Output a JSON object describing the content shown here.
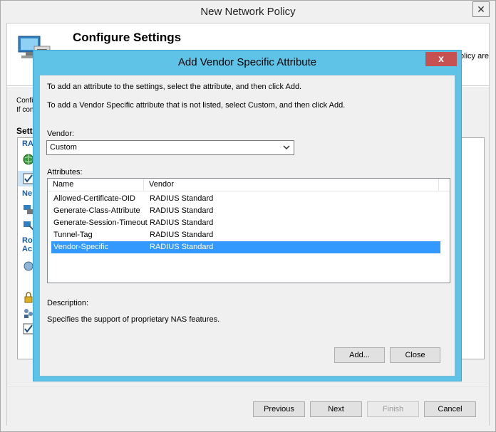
{
  "main_window": {
    "title": "New Network Policy",
    "close_glyph": "✕",
    "header": {
      "title": "Configure Settings",
      "desc_tail": "olicy are"
    },
    "body": {
      "text1": "Confi",
      "text2": "If con",
      "settings_label": "Setti"
    },
    "sidebar": {
      "link_ra": "RA",
      "link_ne": "Ne",
      "link_ro": "Ro",
      "link_ac": "Ac"
    },
    "footer": {
      "previous": "Previous",
      "next": "Next",
      "finish": "Finish",
      "cancel": "Cancel"
    }
  },
  "dialog": {
    "title": "Add Vendor Specific Attribute",
    "close_glyph": "x",
    "instruction1": "To add an attribute to the settings, select the attribute, and then click Add.",
    "instruction2": "To add a Vendor Specific attribute that is not listed, select Custom, and then click Add.",
    "vendor_label": "Vendor:",
    "vendor_value": "Custom",
    "attributes_label": "Attributes:",
    "columns": {
      "name": "Name",
      "vendor": "Vendor"
    },
    "rows": [
      {
        "name": "Allowed-Certificate-OID",
        "vendor": "RADIUS Standard"
      },
      {
        "name": "Generate-Class-Attribute",
        "vendor": "RADIUS Standard"
      },
      {
        "name": "Generate-Session-Timeout",
        "vendor": "RADIUS Standard"
      },
      {
        "name": "Tunnel-Tag",
        "vendor": "RADIUS Standard"
      },
      {
        "name": "Vendor-Specific",
        "vendor": "RADIUS Standard"
      }
    ],
    "selected_row": 4,
    "description_label": "Description:",
    "description_text": "Specifies the support of proprietary NAS features.",
    "add_button": "Add...",
    "close_button": "Close"
  },
  "colors": {
    "dialog_frame": "#5fc3e8",
    "close_red": "#c75050",
    "selection": "#3399ff",
    "link_blue": "#1a5ea6"
  }
}
